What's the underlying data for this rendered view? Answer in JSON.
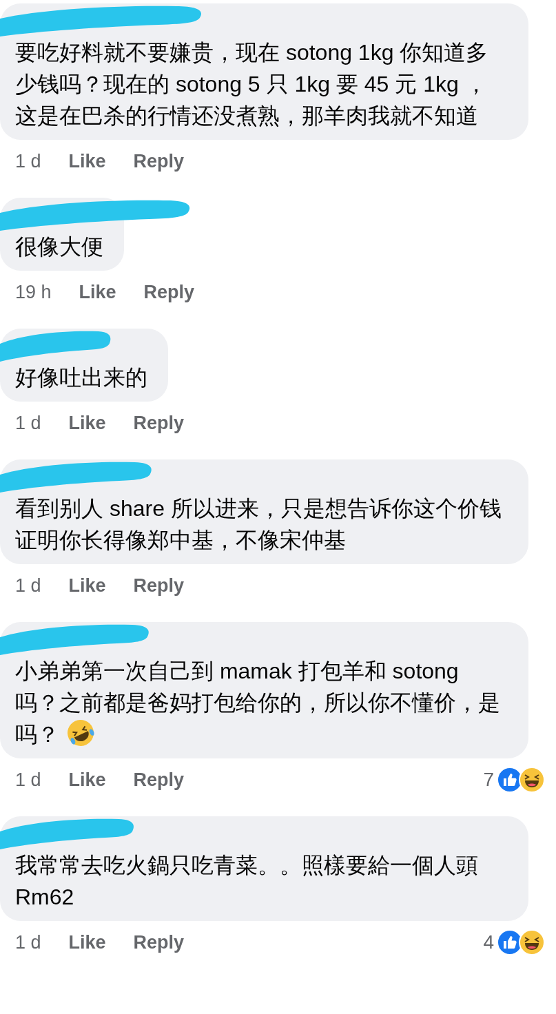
{
  "comments": [
    {
      "text": "要吃好料就不要嫌贵，现在 sotong 1kg 你知道多少钱吗？现在的 sotong 5 只 1kg 要 45 元 1kg ，这是在巴杀的行情还没煮熟，那羊肉我就不知道",
      "time": "1 d",
      "like": "Like",
      "reply": "Reply"
    },
    {
      "text": "很像大便",
      "time": "19 h",
      "like": "Like",
      "reply": "Reply"
    },
    {
      "text": "好像吐出来的",
      "time": "1 d",
      "like": "Like",
      "reply": "Reply"
    },
    {
      "text": "看到别人 share 所以进来，只是想告诉你这个价钱证明你长得像郑中基，不像宋仲基",
      "time": "1 d",
      "like": "Like",
      "reply": "Reply"
    },
    {
      "text": "小弟弟第一次自己到 mamak 打包羊和 sotong 吗？之前都是爸妈打包给你的，所以你不懂价，是吗？",
      "trailing_emoji": true,
      "time": "1 d",
      "like": "Like",
      "reply": "Reply",
      "reactions": {
        "count": "7",
        "icons": [
          {
            "kind": "like"
          },
          {
            "kind": "haha"
          }
        ]
      }
    },
    {
      "text": "我常常去吃火鍋只吃青菜。。照樣要給一個人頭 Rm62",
      "time": "1 d",
      "like": "Like",
      "reply": "Reply",
      "reactions": {
        "count": "4",
        "icons": [
          {
            "kind": "like"
          },
          {
            "kind": "haha"
          }
        ]
      }
    }
  ]
}
